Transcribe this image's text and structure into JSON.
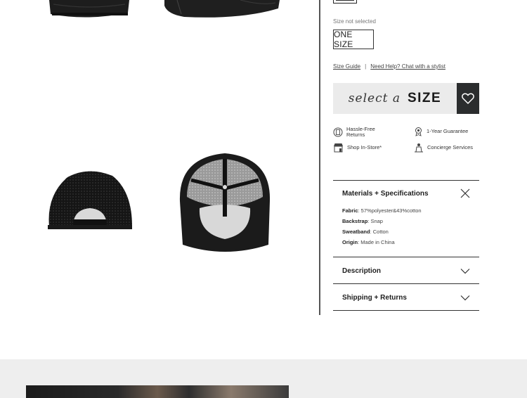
{
  "size": {
    "status": "Size not selected",
    "options": [
      "ONE SIZE"
    ]
  },
  "links": {
    "size_guide": "Size Guide",
    "separator": "|",
    "help": "Need Help? Chat with a stylist"
  },
  "cta": {
    "pre": "select a",
    "main": "SIZE"
  },
  "perks": [
    {
      "label_1": "Hassle-Free",
      "label_2": "Returns",
      "icon": "returns-icon"
    },
    {
      "label_1": "1-Year Guarantee",
      "icon": "guarantee-icon"
    },
    {
      "label_1": "Shop In-Store*",
      "icon": "store-icon"
    },
    {
      "label_1": "Concierge Services",
      "icon": "concierge-icon"
    }
  ],
  "accordion": {
    "materials": {
      "title": "Materials + Specifications",
      "specs": [
        {
          "key": "Fabric",
          "value": ": 57%polyester&43%cotton"
        },
        {
          "key": "Backstrap",
          "value": ": Snap"
        },
        {
          "key": "Sweatband",
          "value": ": Cotton"
        },
        {
          "key": "Origin",
          "value": ": Made in China"
        }
      ]
    },
    "description": {
      "title": "Description"
    },
    "shipping": {
      "title": "Shipping + Returns"
    }
  },
  "colors": {
    "accent_dark": "#2b2d2e",
    "button_bg": "#ebebeb",
    "footer_bg": "#eeeeee"
  }
}
